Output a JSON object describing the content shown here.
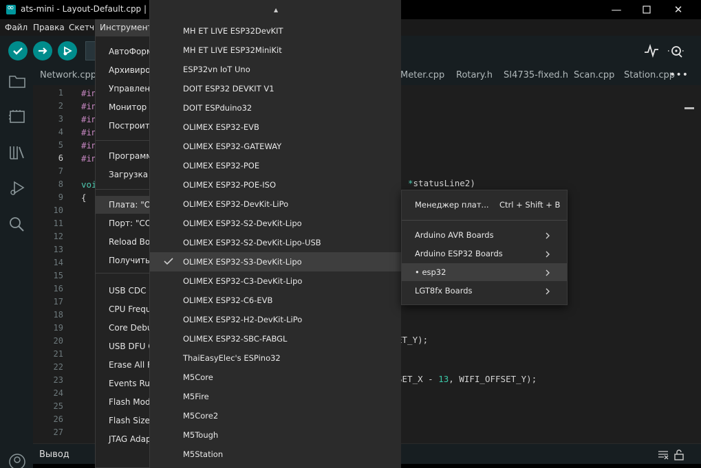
{
  "window": {
    "title": "ats-mini - Layout-Default.cpp | Ardu",
    "minimize_glyph": "—",
    "maximize_glyph": "☐",
    "close_glyph": "✕"
  },
  "menubar": {
    "items": [
      "Файл",
      "Правка",
      "Скетч",
      "Инструменты"
    ],
    "active": "Инструменты"
  },
  "tabs": [
    "Network.cpp",
    "Meter.cpp",
    "Rotary.h",
    "SI4735-fixed.h",
    "Scan.cpp",
    "Station.cpp"
  ],
  "tabs_more": "•••",
  "editor": {
    "line_numbers": [
      "1",
      "2",
      "3",
      "4",
      "5",
      "6",
      "7",
      "8",
      "9",
      "10",
      "11",
      "12",
      "13",
      "14",
      "15",
      "16",
      "17",
      "18",
      "19",
      "20",
      "21",
      "22",
      "23",
      "24",
      "25",
      "26",
      "27"
    ],
    "active_line": "6",
    "left_fragments": [
      {
        "line": 0,
        "text": "#in",
        "cls": "kw"
      },
      {
        "line": 1,
        "text": "#in",
        "cls": "kw"
      },
      {
        "line": 2,
        "text": "#in",
        "cls": "kw"
      },
      {
        "line": 3,
        "text": "#in",
        "cls": "kw"
      },
      {
        "line": 4,
        "text": "#in",
        "cls": "kw"
      },
      {
        "line": 5,
        "text": "#in",
        "cls": "kw"
      },
      {
        "line": 7,
        "text": "voi",
        "cls": "ty"
      },
      {
        "line": 8,
        "text": "{",
        "cls": ""
      }
    ],
    "line8_right_star": "*",
    "line8_right_text": "statusLine2)",
    "line20_right": "ET_Y);",
    "line23_right_a": "SET_X - ",
    "line23_right_num": "13",
    "line23_right_b": ", WIFI_OFFSET_Y);"
  },
  "output": {
    "label": "Вывод"
  },
  "tools_menu": {
    "items": [
      {
        "label": "АвтоФорм",
        "row": 0
      },
      {
        "label": "Архивиров",
        "row": 1
      },
      {
        "label": "Управлени",
        "row": 2
      },
      {
        "label": "Монитор п",
        "row": 3
      },
      {
        "label": "Построить",
        "row": 4
      },
      {
        "label": "Программ",
        "row": 5
      },
      {
        "label": "Загрузка к",
        "row": 6
      },
      {
        "label": "Плата: \"OL",
        "row": 7
      },
      {
        "label": "Порт: \"COM",
        "row": 8
      },
      {
        "label": "Reload Boa",
        "row": 9
      },
      {
        "label": "Получить и",
        "row": 10
      },
      {
        "label": "USB CDC O",
        "row": 11
      },
      {
        "label": "CPU Freque",
        "row": 12
      },
      {
        "label": "Core Debug",
        "row": 13
      },
      {
        "label": "USB DFU O",
        "row": 14
      },
      {
        "label": "Erase All Fla",
        "row": 15
      },
      {
        "label": "Events Run",
        "row": 16
      },
      {
        "label": "Flash Mode",
        "row": 17
      },
      {
        "label": "Flash Size: \"",
        "row": 18
      },
      {
        "label": "JTAG Adapt",
        "row": 19
      }
    ]
  },
  "boards_list": {
    "scroll_up_glyph": "▲",
    "items": [
      "MH ET LIVE ESP32DevKIT",
      "MH ET LIVE ESP32MiniKit",
      "ESP32vn IoT Uno",
      "DOIT ESP32 DEVKIT V1",
      "DOIT ESPduino32",
      "OLIMEX ESP32-EVB",
      "OLIMEX ESP32-GATEWAY",
      "OLIMEX ESP32-POE",
      "OLIMEX ESP32-POE-ISO",
      "OLIMEX ESP32-DevKit-LiPo",
      "OLIMEX ESP32-S2-DevKit-Lipo",
      "OLIMEX ESP32-S2-DevKit-Lipo-USB",
      "OLIMEX ESP32-S3-DevKit-Lipo",
      "OLIMEX ESP32-C3-DevKit-Lipo",
      "OLIMEX ESP32-C6-EVB",
      "OLIMEX ESP32-H2-DevKit-LiPo",
      "OLIMEX ESP32-SBC-FABGL",
      "ThaiEasyElec's ESPino32",
      "M5Core",
      "M5Fire",
      "M5Core2",
      "M5Tough",
      "M5Station"
    ],
    "selected": "OLIMEX ESP32-S3-DevKit-Lipo"
  },
  "board_submenu": {
    "manager_label": "Менеджер плат...",
    "manager_shortcut": "Ctrl + Shift + B",
    "groups": [
      "Arduino AVR Boards",
      "Arduino ESP32 Boards",
      "• esp32",
      "LGT8fx Boards"
    ],
    "active_group": "• esp32"
  },
  "colors": {
    "accent": "#008c8c",
    "background": "#1e1e1e",
    "menu_background": "#2b2b2b"
  }
}
